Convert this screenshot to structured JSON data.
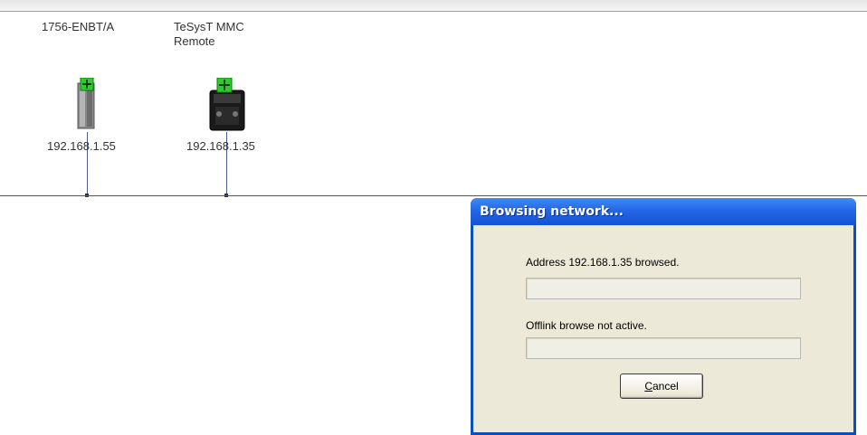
{
  "network": {
    "devices": [
      {
        "name": "1756-ENBT/A",
        "ip": "192.168.1.55",
        "icon": "ethernet-module-icon"
      },
      {
        "name": "TeSysT MMC\nRemote",
        "ip": "192.168.1.35",
        "icon": "motor-controller-icon"
      }
    ]
  },
  "dialog": {
    "title": "Browsing network...",
    "status_1": "Address 192.168.1.35 browsed.",
    "progress_1": 0,
    "status_2": "Offlink browse not active.",
    "progress_2": 0,
    "cancel_label": "Cancel",
    "cancel_mnemonic": "C"
  },
  "colors": {
    "title_bar": "#2566e4",
    "dialog_face": "#ece9d8",
    "device_ok_badge": "#2ecc2e"
  }
}
